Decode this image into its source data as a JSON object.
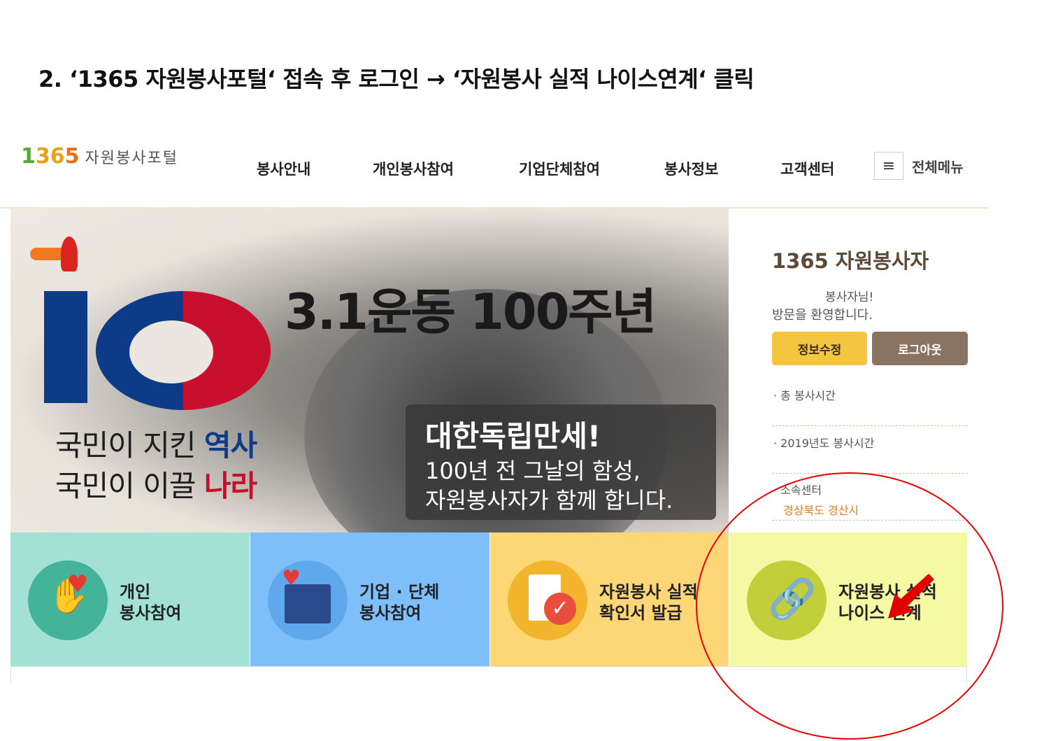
{
  "step": {
    "title": "2. ‘1365 자원봉사포털‘ 접속 후 로그인 →  ‘자원봉사 실적 나이스연계‘ 클릭"
  },
  "header": {
    "logo_number": "1365",
    "logo_text": "자원봉사포털",
    "nav": [
      "봉사안내",
      "개인봉사참여",
      "기업단체참여",
      "봉사정보",
      "고객센터"
    ],
    "all_menu_label": "전체메뉴"
  },
  "banner": {
    "title": "3.1운동 100주년",
    "slogan_line1_prefix": "국민이 지킨 ",
    "slogan_line1_highlight": "역사",
    "slogan_line2_prefix": "국민이 이끌 ",
    "slogan_line2_highlight": "나라",
    "box_line1": "대한독립만세!",
    "box_line2": "100년 전 그날의 함성,",
    "box_line3": "자원봉사자가 함께 합니다."
  },
  "panel": {
    "title": "1365 자원봉사자",
    "greeting1": "봉사자님!",
    "greeting2": "방문을 환영합니다.",
    "edit_button": "정보수정",
    "logout_button": "로그아웃",
    "total_hours_label": "· 총 봉사시간",
    "year_hours_label": "· 2019년도 봉사시간",
    "center_label": "· 소속센터",
    "center_value": "경상북도 경산시"
  },
  "quick_menu": [
    {
      "line1": "개인",
      "line2": "봉사참여",
      "bg": "#a3e1d4",
      "circle": "#43b49a"
    },
    {
      "line1": "기업 · 단체",
      "line2": "봉사참여",
      "bg": "#7fbff9",
      "circle": "#5fa8ec"
    },
    {
      "line1": "자원봉사 실적",
      "line2": "확인서 발급",
      "bg": "#fdd676",
      "circle": "#f3b52d"
    },
    {
      "line1": "자원봉사 실적",
      "line2": "나이스 연계",
      "bg": "#f6f9a3",
      "circle": "#c2cf3a"
    }
  ],
  "colors": {
    "annotation": "#e00000"
  }
}
